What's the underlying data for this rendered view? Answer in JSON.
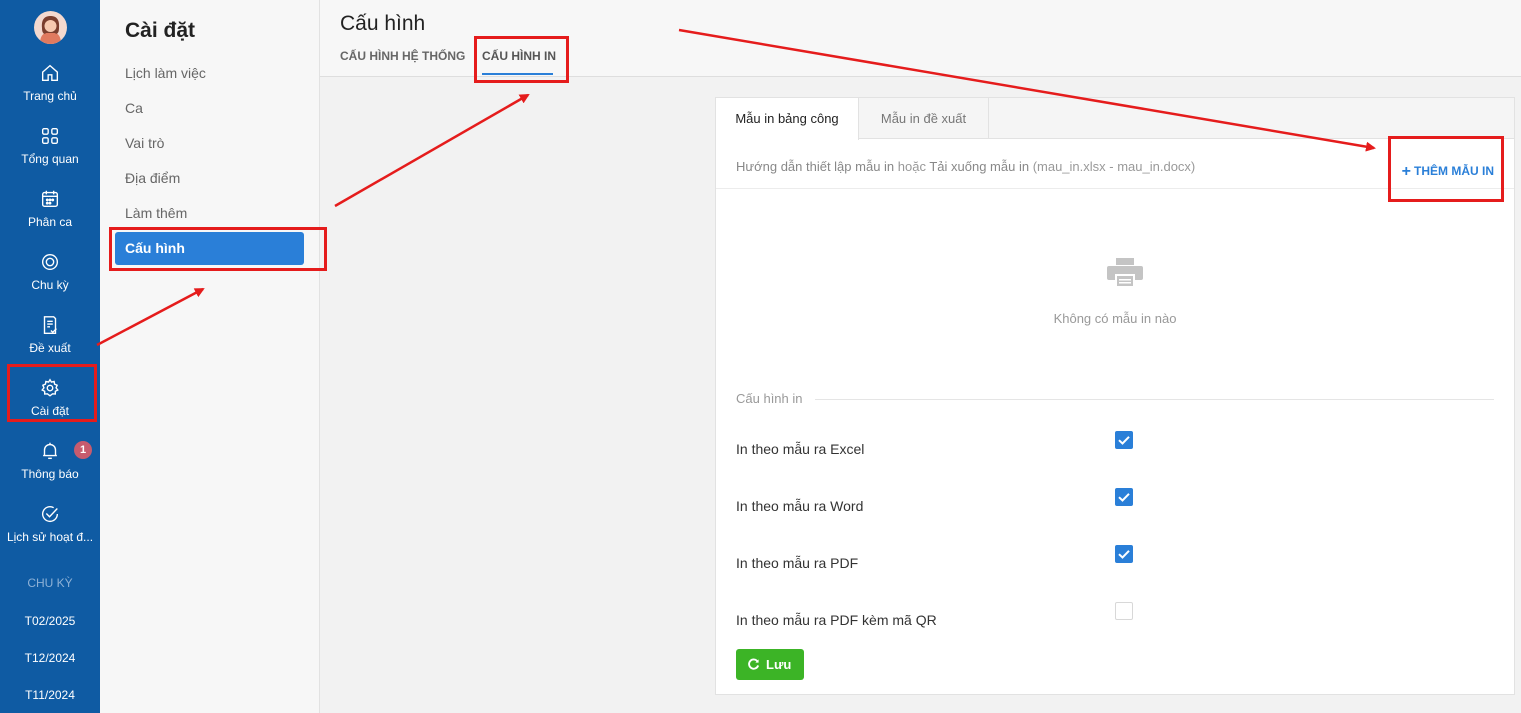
{
  "rail": {
    "items": [
      {
        "label": "Trang chủ",
        "icon": "home-icon"
      },
      {
        "label": "Tổng quan",
        "icon": "grid-icon"
      },
      {
        "label": "Phân ca",
        "icon": "calendar-icon"
      },
      {
        "label": "Chu kỳ",
        "icon": "cycle-icon"
      },
      {
        "label": "Đề xuất",
        "icon": "document-check-icon"
      },
      {
        "label": "Cài đặt",
        "icon": "gear-icon"
      },
      {
        "label": "Thông báo",
        "icon": "bell-icon"
      },
      {
        "label": "Lịch sử hoạt đ...",
        "icon": "check-circle-icon"
      }
    ],
    "notification_badge": "1",
    "period_header": "CHU KỲ",
    "periods": [
      "T02/2025",
      "T12/2024",
      "T11/2024"
    ]
  },
  "settings_menu": {
    "title": "Cài đặt",
    "items": [
      "Lịch làm việc",
      "Ca",
      "Vai trò",
      "Địa điểm",
      "Làm thêm",
      "Cấu hình"
    ],
    "active": "Cấu hình"
  },
  "header": {
    "title": "Cấu hình",
    "tabs": [
      "CẤU HÌNH HỆ THỐNG",
      "CẤU HÌNH IN"
    ],
    "active_tab": "CẤU HÌNH IN"
  },
  "card": {
    "tabs": [
      "Mẫu in bảng công",
      "Mẫu in đề xuất"
    ],
    "active_tab": "Mẫu in bảng công",
    "guide_link": "Hướng dẫn thiết lập mẫu in",
    "guide_or": " hoặc ",
    "download_link": "Tải xuống mẫu in",
    "download_files": " (mau_in.xlsx - mau_in.docx)",
    "add_button": "THÊM MẪU IN",
    "empty_text": "Không có mẫu in nào",
    "section_label": "Cấu hình in",
    "options": [
      {
        "label": "In theo mẫu ra Excel",
        "checked": true
      },
      {
        "label": "In theo mẫu ra Word",
        "checked": true
      },
      {
        "label": "In theo mẫu ra PDF",
        "checked": true
      },
      {
        "label": "In theo mẫu ra PDF kèm mã QR",
        "checked": false
      }
    ],
    "save_button": "Lưu"
  },
  "colors": {
    "rail": "#0f5ba3",
    "accent": "#2a7fd8",
    "save": "#3cb426",
    "annotation": "#e51c1c",
    "badge": "#c75b6e"
  }
}
